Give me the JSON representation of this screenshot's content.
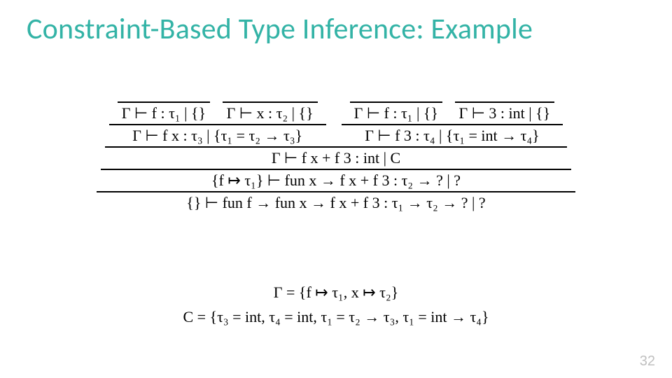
{
  "title": "Constraint-Based Type Inference: Example",
  "slide_number": "32",
  "deriv": {
    "ax_f_left": "Γ ⊢ f : τ₁ | {}",
    "ax_x": "Γ ⊢ x : τ₂ | {}",
    "ax_f_right": "Γ ⊢ f : τ₁ | {}",
    "ax_3": "Γ ⊢ 3 : int | {}",
    "fx": "Γ ⊢ f x : τ₃ | {τ₁ = τ₂ → τ₃}",
    "f3": "Γ ⊢ f 3 : τ₄ | {τ₁ = int → τ₄}",
    "sum": "Γ ⊢ f x + f 3 : int | C",
    "fun_x": "{f ↦ τ₁} ⊢ fun x → f x + f 3 : τ₂ → ? | ?",
    "fun_f": "{} ⊢ fun f → fun x → f x + f 3 : τ₁ → τ₂ → ? | ?"
  },
  "defs": {
    "gamma": "Γ = {f ↦ τ₁, x ↦ τ₂}",
    "C": "C = {τ₃ = int, τ₄ = int, τ₁ = τ₂ → τ₃, τ₁ = int → τ₄}"
  }
}
